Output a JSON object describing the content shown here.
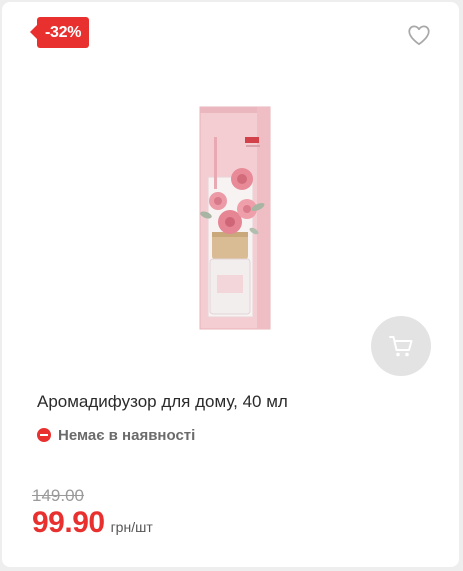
{
  "product": {
    "discount_badge": "-32%",
    "title": "Аромадифузор для дому, 40 мл",
    "availability": "Немає в наявності",
    "old_price": "149.00",
    "price": "99.90",
    "unit": "грн/шт"
  },
  "colors": {
    "accent": "#e8312f",
    "cart_button_bg": "#e3e3e3",
    "package_pink": "#f2c6cb"
  },
  "icons": {
    "favorite": "heart-icon",
    "cart": "cart-icon",
    "availability": "minus-circle-icon"
  }
}
